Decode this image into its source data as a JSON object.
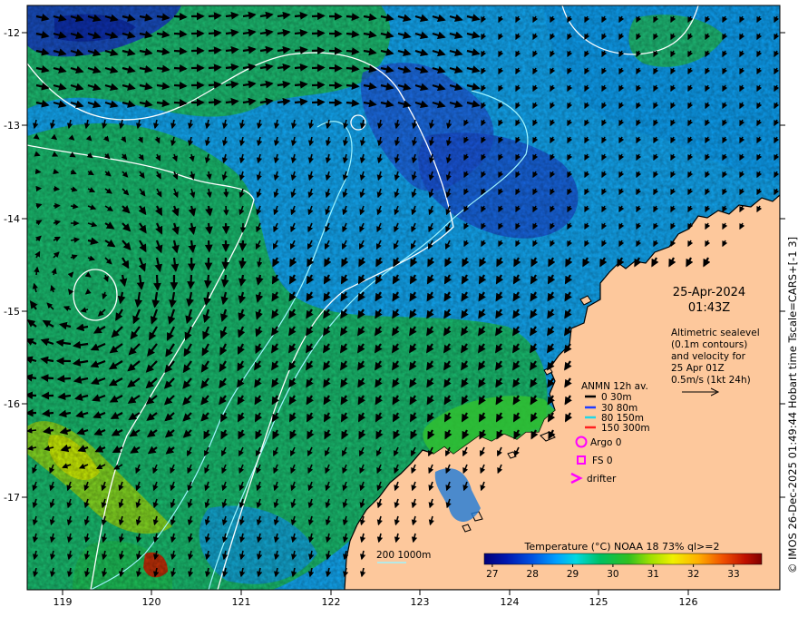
{
  "map": {
    "date": "25-Apr-2024",
    "time": "01:43Z",
    "description_lines": [
      "Altimetric sealevel",
      "(0.1m contours)",
      "and velocity for",
      "25 Apr 01Z",
      "0.5m/s (1kt 24h)"
    ],
    "credit": "© IMOS 26-Dec-2025 01:49:44 Hobart time Tscale=CARS+[-1 3]",
    "lat_ticks": [
      "-12",
      "-13",
      "-14",
      "-15",
      "-16",
      "-17"
    ],
    "lon_ticks": [
      "119",
      "120",
      "121",
      "122",
      "123",
      "124",
      "125",
      "126"
    ],
    "legend": {
      "title": "ANMN 12h av.",
      "items": [
        {
          "label": "0 30m",
          "color": "#000000"
        },
        {
          "label": "30 80m",
          "color": "#1f3cff"
        },
        {
          "label": "80 150m",
          "color": "#22d6e6"
        },
        {
          "label": "150 300m",
          "color": "#ff2020"
        }
      ],
      "argo": "Argo 0",
      "fs": "FS 0",
      "drifter": "drifter",
      "marker_color": "#ff00ff"
    },
    "isobath_label": "200  1000m",
    "colorbar": {
      "title": "Temperature (°C) NOAA 18 73% ql>=2",
      "ticks": [
        "27",
        "28",
        "29",
        "30",
        "31",
        "32",
        "33"
      ],
      "min": 26.8,
      "max": 33.7
    },
    "colors": {
      "land": "#fdc89c",
      "coast": "#000000",
      "isobath_200": "#9ff4ff",
      "sealevel_contour": "#ffffff"
    }
  }
}
